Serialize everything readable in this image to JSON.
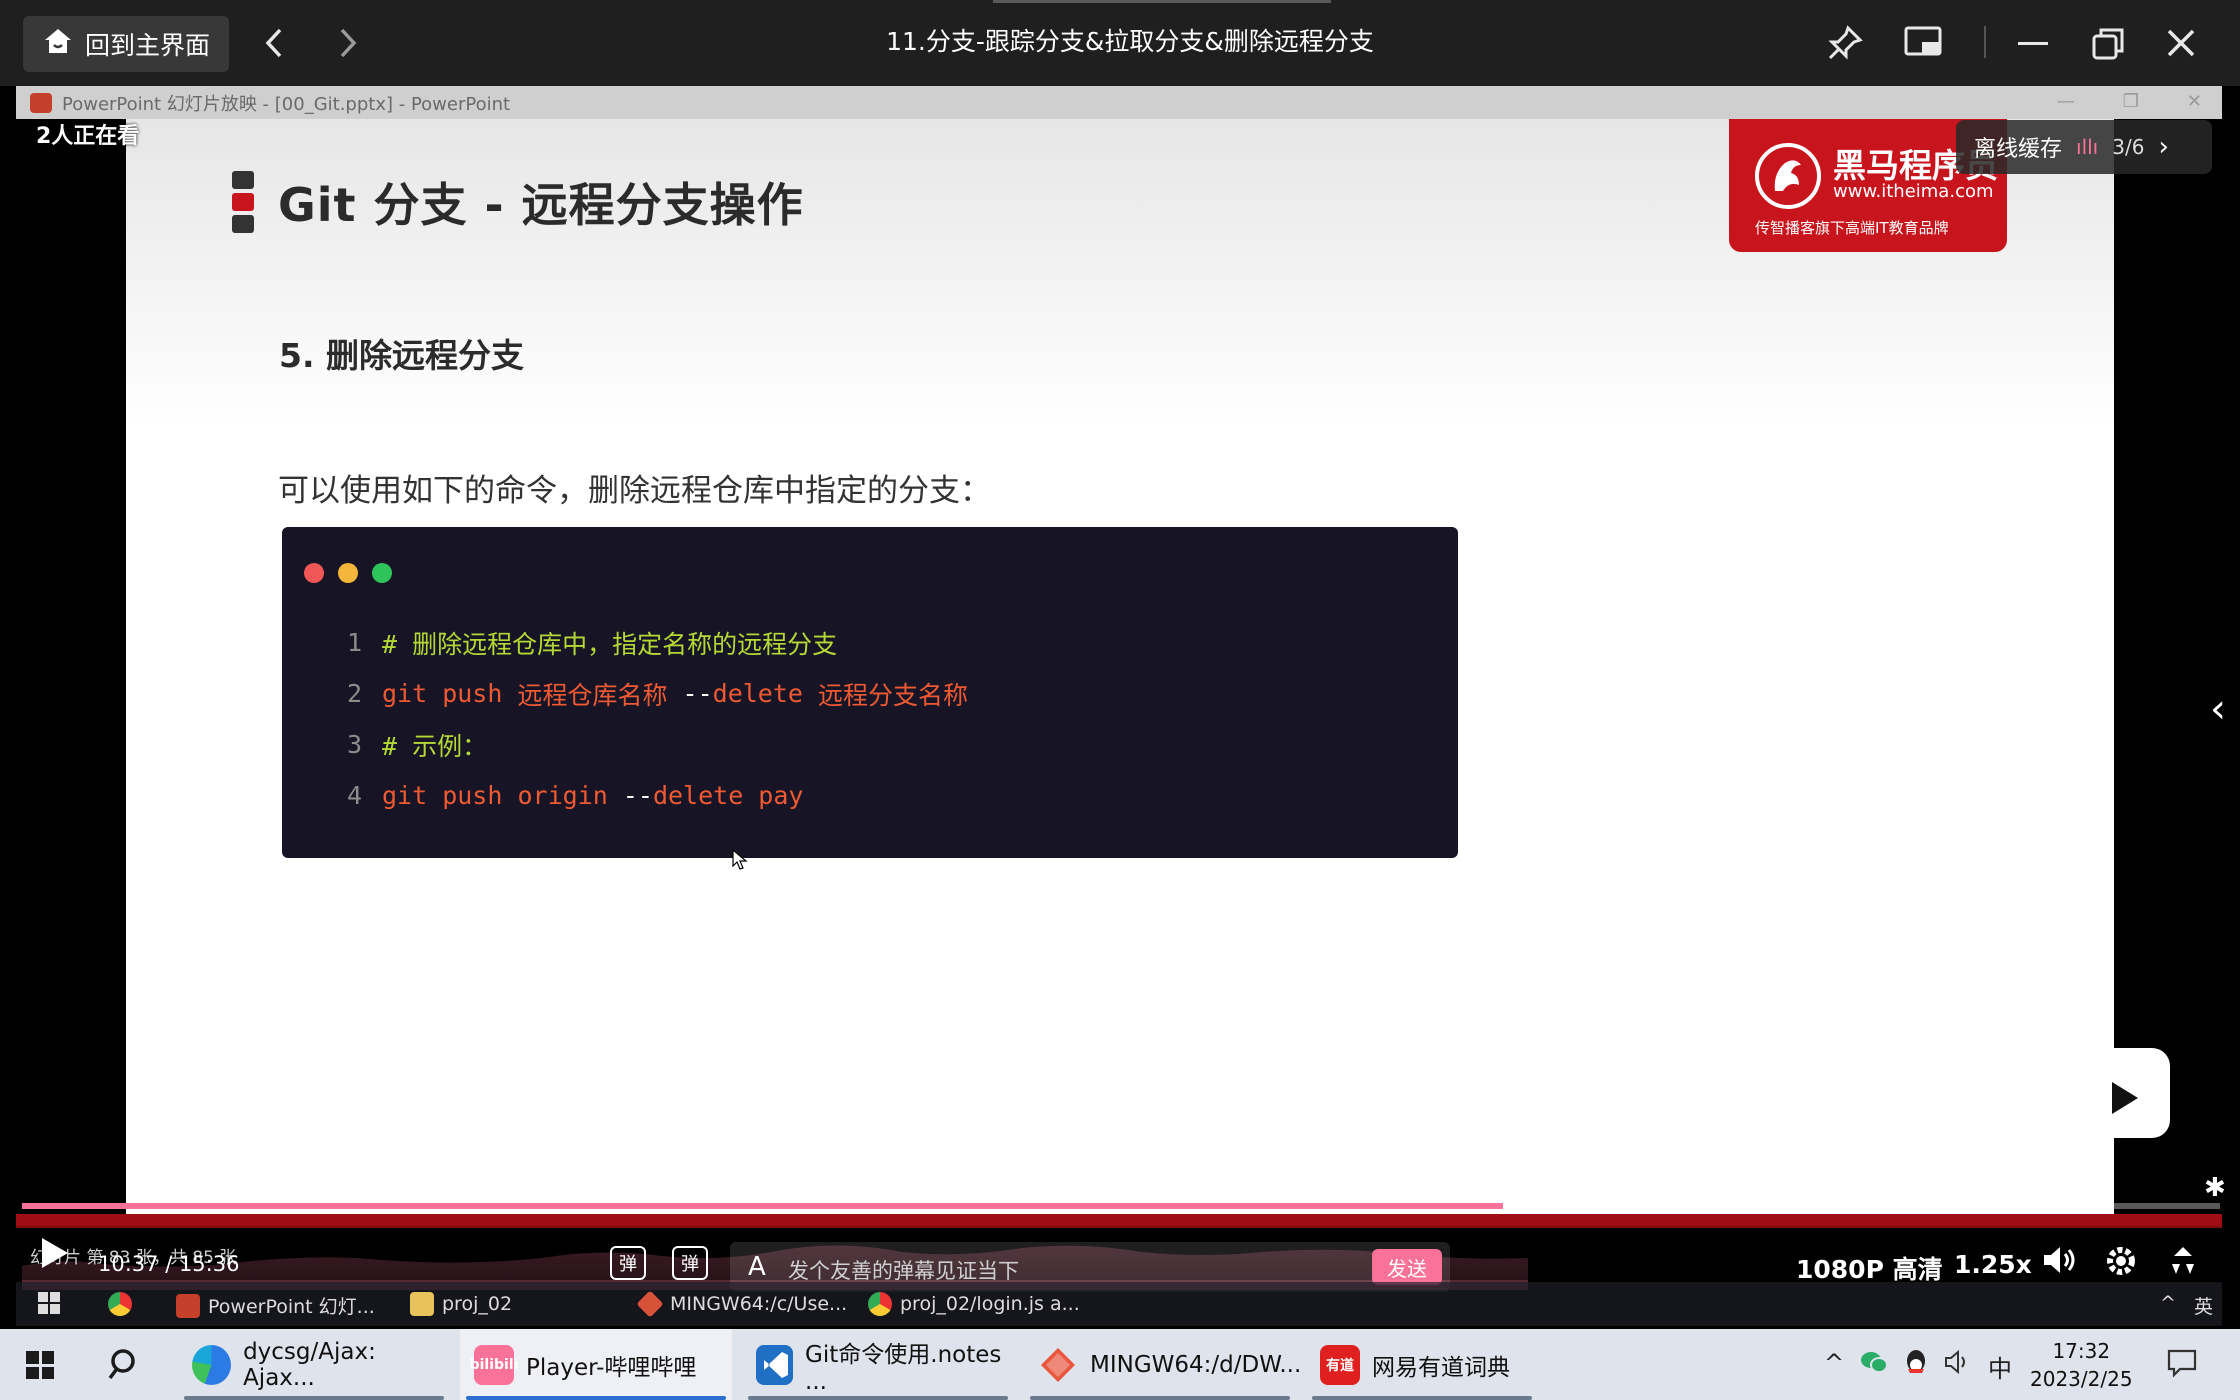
{
  "titlebar": {
    "home_label": "回到主界面",
    "title": "11.分支-跟踪分支&拉取分支&删除远程分支"
  },
  "ppt_window": {
    "title": "PowerPoint 幻灯片放映 - [00_Git.pptx] - PowerPoint"
  },
  "overlay": {
    "viewers": "2人正在看",
    "offline_cache": "离线缓存",
    "page_indicator": "3/6"
  },
  "slide": {
    "title": "Git 分支 - 远程分支操作",
    "logo_name": "黑马程序员",
    "logo_url": "www.itheima.com",
    "logo_slogan": "传智播客旗下高端IT教育品牌",
    "section": "5. 删除远程分支",
    "description": "可以使用如下的命令，删除远程仓库中指定的分支：",
    "code": {
      "lines": [
        {
          "num": "1",
          "comment": "# 删除远程仓库中，指定名称的远程分支"
        },
        {
          "num": "2",
          "cmd": "git push",
          "arg1": " 远程仓库名称 ",
          "flag_dash": "--",
          "flag": "delete",
          "arg2": " 远程分支名称"
        },
        {
          "num": "3",
          "comment": "# 示例："
        },
        {
          "num": "4",
          "cmd": "git push origin ",
          "flag_dash": "--",
          "flag": "delete pay"
        }
      ]
    }
  },
  "controls": {
    "slide_count": "幻灯片 第 83 张，共 85 张",
    "time": "10:37 / 15:36",
    "danmaku_icon_1": "弹",
    "danmaku_icon_2": "弹",
    "danmaku_placeholder": "发个友善的弹幕见证当下",
    "send": "发送",
    "quality": "1080P 高清",
    "speed": "1.25x",
    "progress": 0.674
  },
  "inner_taskbar": {
    "items": [
      {
        "label": "PowerPoint 幻灯..."
      },
      {
        "label": "proj_02"
      },
      {
        "label": "MINGW64:/c/Use..."
      },
      {
        "label": "proj_02/login.js a..."
      }
    ],
    "ime": "英"
  },
  "taskbar": {
    "items": [
      {
        "label": "dycsg/Ajax: Ajax..."
      },
      {
        "label": "Player-哔哩哔哩"
      },
      {
        "label": "Git命令使用.notes ..."
      },
      {
        "label": "MINGW64:/d/DW..."
      },
      {
        "label": "网易有道词典"
      }
    ],
    "bili_icon_text": "bilibili",
    "youdao_icon_text": "有道",
    "ime": "中",
    "time": "17:32",
    "date": "2023/2/25"
  },
  "colors": {
    "accent_pink": "#fb7299",
    "brand_red": "#c8141d",
    "code_bg": "#161425",
    "comment_green": "#b5d934",
    "command_orange": "#ef5a32"
  }
}
